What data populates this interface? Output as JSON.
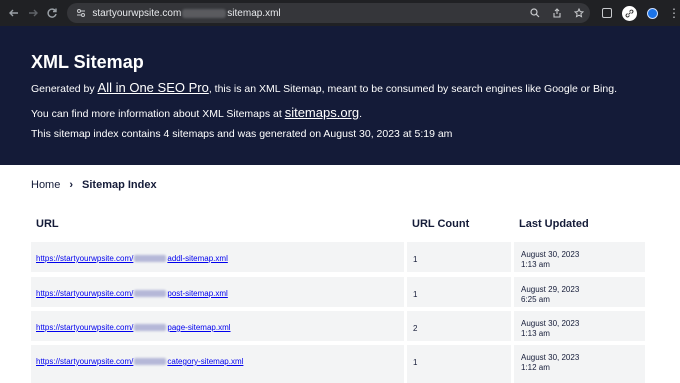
{
  "browser": {
    "url_prefix": "startyourwpsite.com",
    "url_suffix": "sitemap.xml"
  },
  "header": {
    "title": "XML Sitemap",
    "generated_prefix": "Generated by ",
    "generated_link": "All in One SEO Pro",
    "generated_suffix": ", this is an XML Sitemap, meant to be consumed by search engines like Google or Bing.",
    "info_prefix": "You can find more information about XML Sitemaps at ",
    "info_link": "sitemaps.org",
    "info_suffix": ".",
    "index_text": "This sitemap index contains 4 sitemaps and was generated on August 30, 2023 at 5:19 am"
  },
  "breadcrumb": {
    "home": "Home",
    "separator": "›",
    "current": "Sitemap Index"
  },
  "table": {
    "headers": {
      "url": "URL",
      "count": "URL Count",
      "updated": "Last Updated"
    },
    "rows": [
      {
        "url_prefix": "https://startyourwpsite.com/",
        "url_suffix": "addl-sitemap.xml",
        "count": "1",
        "date": "August 30, 2023",
        "time": "1:13 am"
      },
      {
        "url_prefix": "https://startyourwpsite.com/",
        "url_suffix": "post-sitemap.xml",
        "count": "1",
        "date": "August 29, 2023",
        "time": "6:25 am"
      },
      {
        "url_prefix": "https://startyourwpsite.com/",
        "url_suffix": "page-sitemap.xml",
        "count": "2",
        "date": "August 30, 2023",
        "time": "1:13 am"
      },
      {
        "url_prefix": "https://startyourwpsite.com/",
        "url_suffix": "category-sitemap.xml",
        "count": "1",
        "date": "August 30, 2023",
        "time": "1:12 am"
      }
    ]
  }
}
